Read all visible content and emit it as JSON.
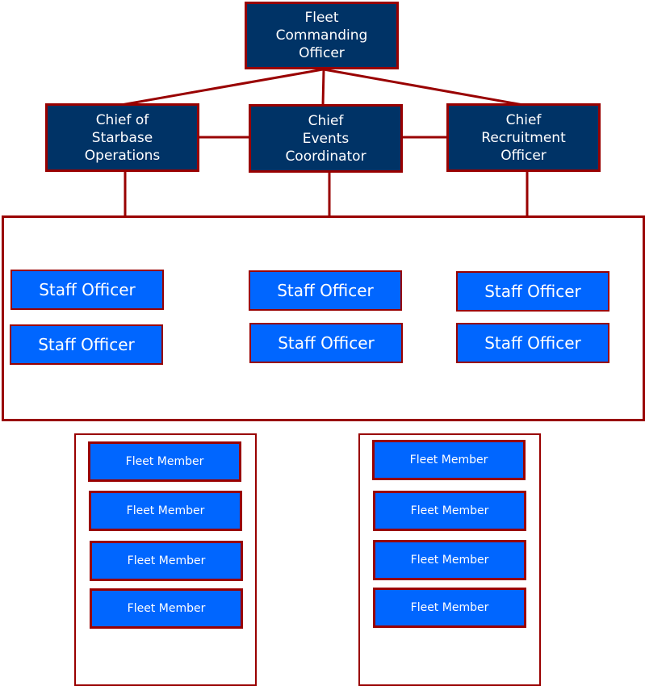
{
  "colors": {
    "border": "#990000",
    "leadership_fill": "#003366",
    "staff_fill": "#0066ff",
    "text": "#ffffff"
  },
  "commander": {
    "label": "Fleet\nCommanding\nOfficer"
  },
  "chiefs": [
    {
      "label": "Chief of\nStarbase\nOperations"
    },
    {
      "label": "Chief\nEvents\nCoordinator"
    },
    {
      "label": "Chief\nRecruitment\nOfficer"
    }
  ],
  "staff_officers": [
    {
      "label": "Staff Officer"
    },
    {
      "label": "Staff Officer"
    },
    {
      "label": "Staff Officer"
    },
    {
      "label": "Staff Officer"
    },
    {
      "label": "Staff Officer"
    },
    {
      "label": "Staff Officer"
    }
  ],
  "member_groups": [
    {
      "members": [
        "Fleet Member",
        "Fleet Member",
        "Fleet Member",
        "Fleet Member"
      ]
    },
    {
      "members": [
        "Fleet Member",
        "Fleet Member",
        "Fleet Member",
        "Fleet Member"
      ]
    }
  ]
}
